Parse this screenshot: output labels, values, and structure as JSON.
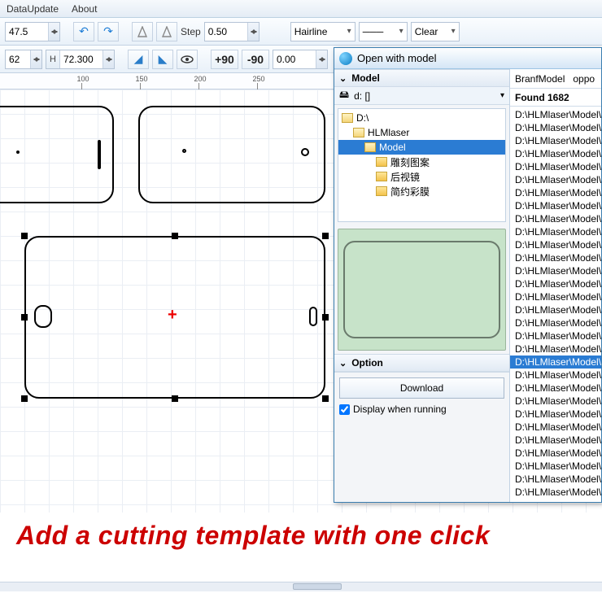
{
  "menu": {
    "dataUpdate": "DataUpdate",
    "about": "About"
  },
  "toolbar": {
    "val1": "47.5",
    "step_label": "Step",
    "step_val": "0.50",
    "hairline": "Hairline",
    "linePreview": "───",
    "clear": "Clear",
    "widthVal": "62",
    "heightLabel": "H",
    "heightVal": "72.300",
    "rot_plus": "+90",
    "rot_minus": "-90",
    "angle": "0.00"
  },
  "ruler": {
    "t100": "100",
    "t150": "150",
    "t200": "200",
    "t250": "250"
  },
  "panel": {
    "title": "Open with model",
    "model_hdr": "Model",
    "drive": "d: []",
    "tree": {
      "root": "D:\\",
      "hlm": "HLMlaser",
      "model": "Model",
      "n1": "雕刻图案",
      "n2": "后视镜",
      "n3": "简约彩膜"
    },
    "option_hdr": "Option",
    "download": "Download",
    "display_when_running": "Display when running",
    "brand_label": "BranfModel",
    "brand_value": "oppo",
    "found": "Found 1682",
    "path_prefix": "D:\\HLMlaser\\Model\\oppo",
    "path_prefix_r": "D:\\HLMlaser\\Model\\oppor",
    "selected_index": 19
  },
  "caption": "Add a cutting template with one click"
}
